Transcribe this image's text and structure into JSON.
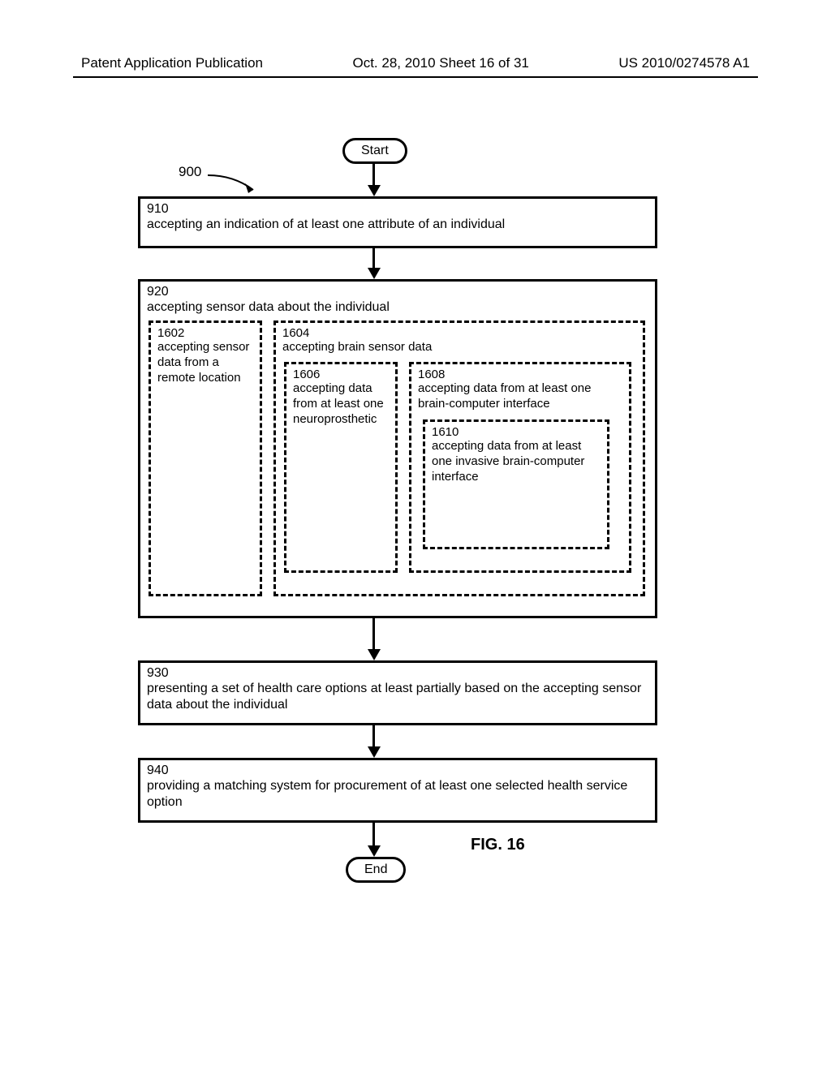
{
  "header": {
    "left": "Patent Application Publication",
    "mid": "Oct. 28, 2010  Sheet 16 of 31",
    "right": "US 2010/0274578 A1"
  },
  "ref": {
    "label": "900"
  },
  "start": {
    "label": "Start"
  },
  "end": {
    "label": "End"
  },
  "box910": {
    "num": "910",
    "txt": "accepting an indication of at least one attribute of an individual"
  },
  "box920": {
    "num": "920",
    "txt": "accepting sensor data about the individual"
  },
  "box1602": {
    "num": "1602",
    "txt": "accepting sensor data from a remote location"
  },
  "box1604": {
    "num": "1604",
    "txt": "accepting brain sensor data"
  },
  "box1606": {
    "num": "1606",
    "txt": "accepting data from at least one neuroprosthetic"
  },
  "box1608": {
    "num": "1608",
    "txt": "accepting data from at least one brain-computer interface"
  },
  "box1610": {
    "num": "1610",
    "txt": "accepting data from at least one invasive brain-computer interface"
  },
  "box930": {
    "num": "930",
    "txt": "presenting a set of health care options at least partially based on the accepting sensor data about the individual"
  },
  "box940": {
    "num": "940",
    "txt": "providing a matching system for procurement of at least one selected health service option"
  },
  "figure": {
    "label": "FIG. 16"
  }
}
